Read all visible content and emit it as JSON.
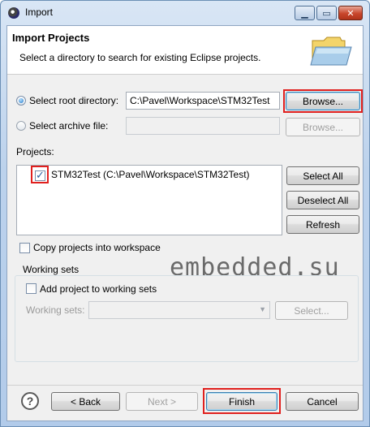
{
  "window": {
    "title": "Import",
    "icon": "eclipse-icon",
    "controls": [
      "minimize-icon",
      "maximize-icon",
      "close-icon"
    ]
  },
  "banner": {
    "title": "Import Projects",
    "description": "Select a directory to search for existing Eclipse projects.",
    "icon": "folder-icon"
  },
  "source": {
    "root_label": "Select root directory:",
    "root_value": "C:\\Pavel\\Workspace\\STM32Test",
    "root_browse": "Browse...",
    "archive_label": "Select archive file:",
    "archive_value": "",
    "archive_browse": "Browse..."
  },
  "projects": {
    "label": "Projects:",
    "items": [
      {
        "label": "STM32Test (C:\\Pavel\\Workspace\\STM32Test)",
        "checked": true
      }
    ],
    "select_all": "Select All",
    "deselect_all": "Deselect All",
    "refresh": "Refresh"
  },
  "options": {
    "copy_label": "Copy projects into workspace",
    "copy_checked": false
  },
  "working_sets": {
    "group_label": "Working sets",
    "add_label": "Add project to working sets",
    "add_checked": false,
    "sets_label": "Working sets:",
    "sets_value": "",
    "select_button": "Select..."
  },
  "watermark": "embedded.su",
  "footer": {
    "help_icon": "help-icon",
    "back": "< Back",
    "next": "Next >",
    "finish": "Finish",
    "cancel": "Cancel"
  },
  "colors": {
    "highlight": "#e0201e",
    "accent": "#1c74c8"
  }
}
